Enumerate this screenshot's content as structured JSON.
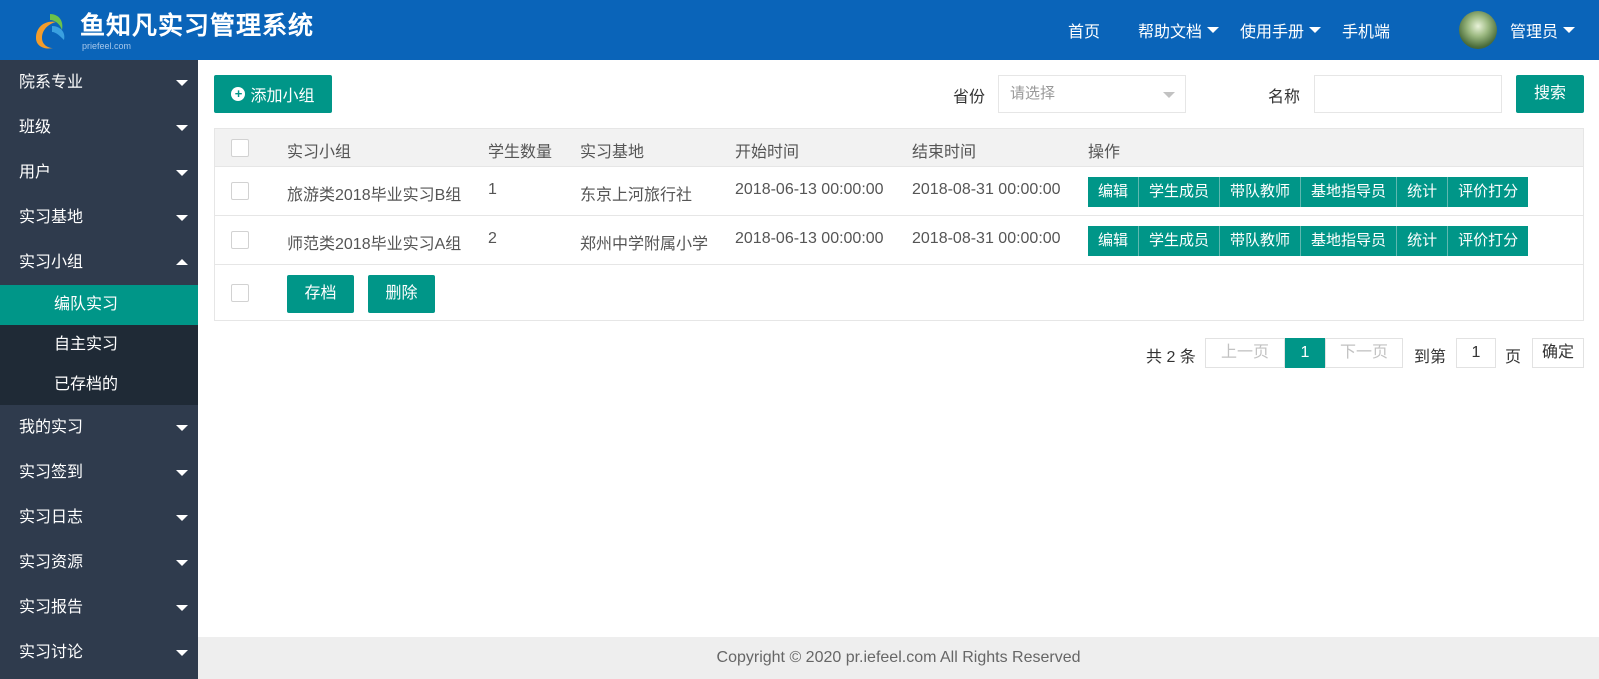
{
  "header": {
    "app_title": "鱼知凡实习管理系统",
    "app_subtitle": "priefeel.com",
    "nav": {
      "home": "首页",
      "help_docs": "帮助文档",
      "manual": "使用手册",
      "mobile": "手机端",
      "user": "管理员"
    }
  },
  "sidebar": {
    "items": [
      {
        "label": "院系专业"
      },
      {
        "label": "班级"
      },
      {
        "label": "用户"
      },
      {
        "label": "实习基地"
      },
      {
        "label": "实习小组"
      }
    ],
    "subitems": [
      {
        "label": "编队实习"
      },
      {
        "label": "自主实习"
      },
      {
        "label": "已存档的"
      }
    ],
    "items_after": [
      {
        "label": "我的实习"
      },
      {
        "label": "实习签到"
      },
      {
        "label": "实习日志"
      },
      {
        "label": "实习资源"
      },
      {
        "label": "实习报告"
      },
      {
        "label": "实习讨论"
      }
    ]
  },
  "toolbar": {
    "add_label": "添加小组",
    "province_label": "省份",
    "province_placeholder": "请选择",
    "name_label": "名称",
    "search_label": "搜索"
  },
  "table": {
    "columns": [
      "实习小组",
      "学生数量",
      "实习基地",
      "开始时间",
      "结束时间",
      "操作"
    ],
    "rows": [
      {
        "group": "旅游类2018毕业实习B组",
        "count": "1",
        "base": "东京上河旅行社",
        "start": "2018-06-13 00:00:00",
        "end": "2018-08-31 00:00:00"
      },
      {
        "group": "师范类2018毕业实习A组",
        "count": "2",
        "base": "郑州中学附属小学",
        "start": "2018-06-13 00:00:00",
        "end": "2018-08-31 00:00:00"
      }
    ],
    "actions": [
      "编辑",
      "学生成员",
      "带队教师",
      "基地指导员",
      "统计",
      "评价打分"
    ],
    "archive_label": "存档",
    "delete_label": "删除"
  },
  "pagination": {
    "total": "共 2 条",
    "prev": "上一页",
    "current": "1",
    "next": "下一页",
    "goto": "到第",
    "goto_value": "1",
    "page_unit": "页",
    "confirm": "确定"
  },
  "footer": {
    "copyright": "Copyright © 2020 pr.iefeel.com All Rights Reserved"
  },
  "colors": {
    "header": "#0a64b9",
    "sidebar": "#2f3b4d",
    "accent": "#009688"
  }
}
